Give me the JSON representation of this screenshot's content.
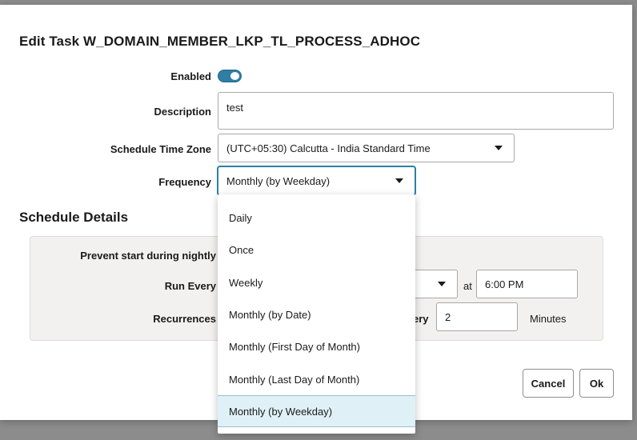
{
  "dialog": {
    "title": "Edit Task W_DOMAIN_MEMBER_LKP_TL_PROCESS_ADHOC"
  },
  "form": {
    "enabled_label": "Enabled",
    "enabled_value": true,
    "description_label": "Description",
    "description_value": "test",
    "timezone_label": "Schedule Time Zone",
    "timezone_value": "(UTC+05:30) Calcutta - India Standard Time",
    "frequency_label": "Frequency",
    "frequency_value": "Monthly (by Weekday)"
  },
  "schedule": {
    "title": "Schedule Details",
    "prevent_label": "Prevent start during nightly",
    "run_every_label": "Run Every",
    "at_label": "at",
    "time_value": "6:00 PM",
    "recurrences_label": "Recurrences",
    "every_label_partial": "ery",
    "interval_value": "2",
    "interval_unit": "Minutes"
  },
  "buttons": {
    "cancel": "Cancel",
    "ok": "Ok"
  },
  "frequency_options": [
    "Daily",
    "Once",
    "Weekly",
    "Monthly (by Date)",
    "Monthly (First Day of Month)",
    "Monthly (Last Day of Month)",
    "Monthly (by Weekday)"
  ],
  "colors": {
    "accent": "#2e7fa3",
    "selected_option_bg": "#dff0f6",
    "panel_bg": "#f2f1ef"
  }
}
